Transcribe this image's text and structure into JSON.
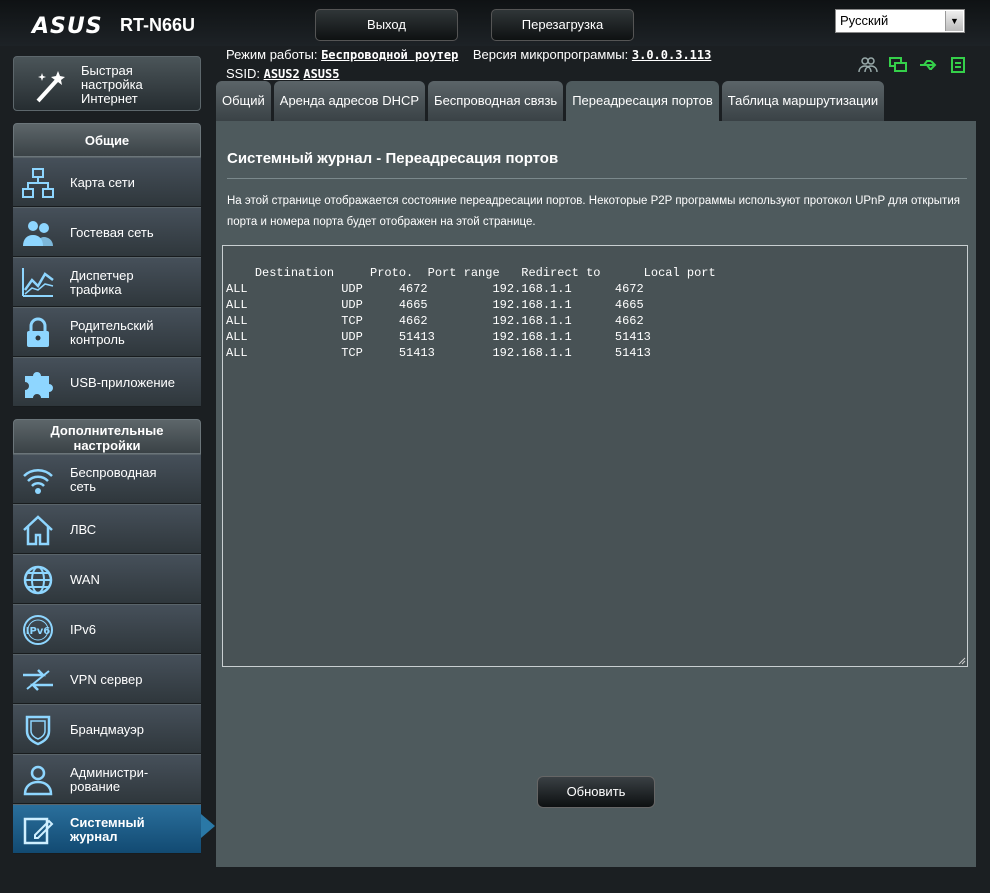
{
  "header": {
    "brand": "ASUS",
    "model": "RT-N66U",
    "logout_label": "Выход",
    "reboot_label": "Перезагрузка",
    "language": "Русский"
  },
  "status": {
    "mode_label": "Режим работы:",
    "mode_value": "Беспроводной роутер",
    "firmware_label": "Версия микропрограммы:",
    "firmware_value": "3.0.0.3.113",
    "ssid_label": "SSID:",
    "ssid_1": "ASUS2",
    "ssid_2": "ASUS5"
  },
  "sidebar": {
    "quick_setup": "Быстрая\nнастройка\nИнтернет",
    "general_title": "Общие",
    "general_items": [
      {
        "label": "Карта сети"
      },
      {
        "label": "Гостевая сеть"
      },
      {
        "label": "Диспетчер\nтрафика"
      },
      {
        "label": "Родительский\nконтроль"
      },
      {
        "label": "USB-приложение"
      }
    ],
    "advanced_title": "Дополнительные\nнастройки",
    "advanced_items": [
      {
        "label": "Беспроводная\nсеть"
      },
      {
        "label": "ЛВС"
      },
      {
        "label": "WAN"
      },
      {
        "label": "IPv6"
      },
      {
        "label": "VPN сервер"
      },
      {
        "label": "Брандмауэр"
      },
      {
        "label": "Администри-\nрование"
      },
      {
        "label": "Системный\nжурнал"
      }
    ]
  },
  "tabs": [
    {
      "label": "Общий"
    },
    {
      "label": "Аренда адресов DHCP"
    },
    {
      "label": "Беспроводная связь"
    },
    {
      "label": "Переадресация портов"
    },
    {
      "label": "Таблица маршрутизации"
    }
  ],
  "main": {
    "title": "Системный журнал - Переадресация портов",
    "description": "На этой странице отображается состояние переадресации портов. Некоторые P2P программы используют протокол UPnP для открытия порта и номера порта будет отображен на этой странице.",
    "log_text": "Destination     Proto.  Port range   Redirect to      Local port\nALL             UDP     4672         192.168.1.1      4672\nALL             UDP     4665         192.168.1.1      4665\nALL             TCP     4662         192.168.1.1      4662\nALL             UDP     51413        192.168.1.1      51413\nALL             TCP     51413        192.168.1.1      51413",
    "refresh_label": "Обновить"
  },
  "colors": {
    "accent": "#2a78a6",
    "panel": "#4e5a5d",
    "status_icon_green": "#35d04a"
  }
}
